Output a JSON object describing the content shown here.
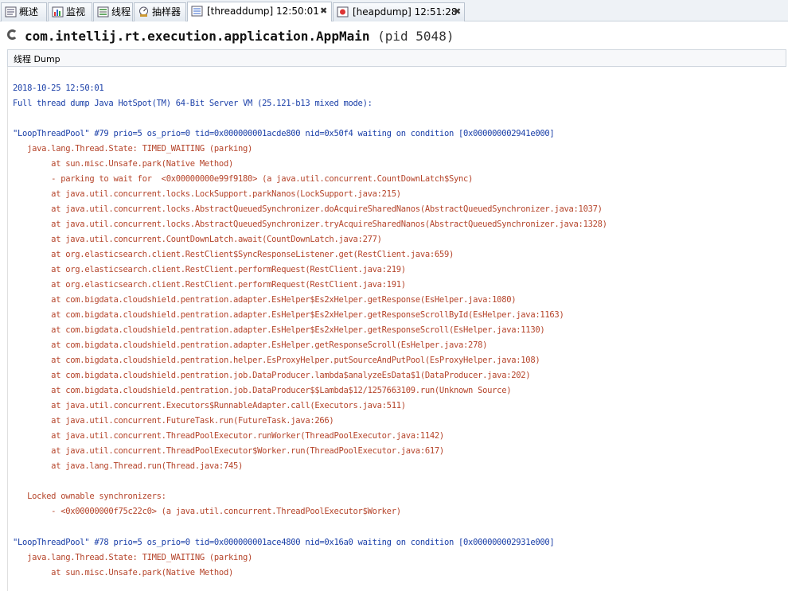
{
  "tabs": [
    {
      "label": "概述",
      "icon": "overview-icon"
    },
    {
      "label": "监视",
      "icon": "monitor-chart-icon"
    },
    {
      "label": "线程",
      "icon": "threads-icon"
    },
    {
      "label": "抽样器",
      "icon": "sampler-icon"
    },
    {
      "label": "[threaddump] 12:50:01",
      "icon": "thread-dump-icon",
      "close": "✖",
      "active": true
    },
    {
      "label": "[heapdump] 12:51:28",
      "icon": "heap-dump-icon",
      "close": "✖"
    }
  ],
  "header": {
    "app_name": "com.intellij.rt.execution.application.AppMain",
    "pid": "(pid 5048)"
  },
  "subtab": {
    "label": "线程 Dump"
  },
  "dump": {
    "lines": [
      "2018-10-25 12:50:01",
      "Full thread dump Java HotSpot(TM) 64-Bit Server VM (25.121-b13 mixed mode):",
      "\"LoopThreadPool\" #79 prio=5 os_prio=0 tid=0x000000001acde800 nid=0x50f4 waiting on condition [0x000000002941e000]",
      "   java.lang.Thread.State: TIMED_WAITING (parking)",
      "        at sun.misc.Unsafe.park(Native Method)",
      "        - parking to wait for  <0x00000000e99f9180> (a java.util.concurrent.CountDownLatch$Sync)",
      "        at java.util.concurrent.locks.LockSupport.parkNanos(LockSupport.java:215)",
      "        at java.util.concurrent.locks.AbstractQueuedSynchronizer.doAcquireSharedNanos(AbstractQueuedSynchronizer.java:1037)",
      "        at java.util.concurrent.locks.AbstractQueuedSynchronizer.tryAcquireSharedNanos(AbstractQueuedSynchronizer.java:1328)",
      "        at java.util.concurrent.CountDownLatch.await(CountDownLatch.java:277)",
      "        at org.elasticsearch.client.RestClient$SyncResponseListener.get(RestClient.java:659)",
      "        at org.elasticsearch.client.RestClient.performRequest(RestClient.java:219)",
      "        at org.elasticsearch.client.RestClient.performRequest(RestClient.java:191)",
      "        at com.bigdata.cloudshield.pentration.adapter.EsHelper$Es2xHelper.getResponse(EsHelper.java:1080)",
      "        at com.bigdata.cloudshield.pentration.adapter.EsHelper$Es2xHelper.getResponseScrollById(EsHelper.java:1163)",
      "        at com.bigdata.cloudshield.pentration.adapter.EsHelper$Es2xHelper.getResponseScroll(EsHelper.java:1130)",
      "        at com.bigdata.cloudshield.pentration.adapter.EsHelper.getResponseScroll(EsHelper.java:278)",
      "        at com.bigdata.cloudshield.pentration.helper.EsProxyHelper.putSourceAndPutPool(EsProxyHelper.java:108)",
      "        at com.bigdata.cloudshield.pentration.job.DataProducer.lambda$analyzeEsData$1(DataProducer.java:202)",
      "        at com.bigdata.cloudshield.pentration.job.DataProducer$$Lambda$12/1257663109.run(Unknown Source)",
      "        at java.util.concurrent.Executors$RunnableAdapter.call(Executors.java:511)",
      "        at java.util.concurrent.FutureTask.run(FutureTask.java:266)",
      "        at java.util.concurrent.ThreadPoolExecutor.runWorker(ThreadPoolExecutor.java:1142)",
      "        at java.util.concurrent.ThreadPoolExecutor$Worker.run(ThreadPoolExecutor.java:617)",
      "        at java.lang.Thread.run(Thread.java:745)",
      "   Locked ownable synchronizers:",
      "        - <0x00000000f75c22c0> (a java.util.concurrent.ThreadPoolExecutor$Worker)",
      "\"LoopThreadPool\" #78 prio=5 os_prio=0 tid=0x000000001ace4800 nid=0x16a0 waiting on condition [0x000000002931e000]",
      "   java.lang.Thread.State: TIMED_WAITING (parking)",
      "        at sun.misc.Unsafe.park(Native Method)"
    ]
  },
  "colors": {
    "header_text": "#1a3fa8",
    "stack_text": "#b5442a"
  }
}
